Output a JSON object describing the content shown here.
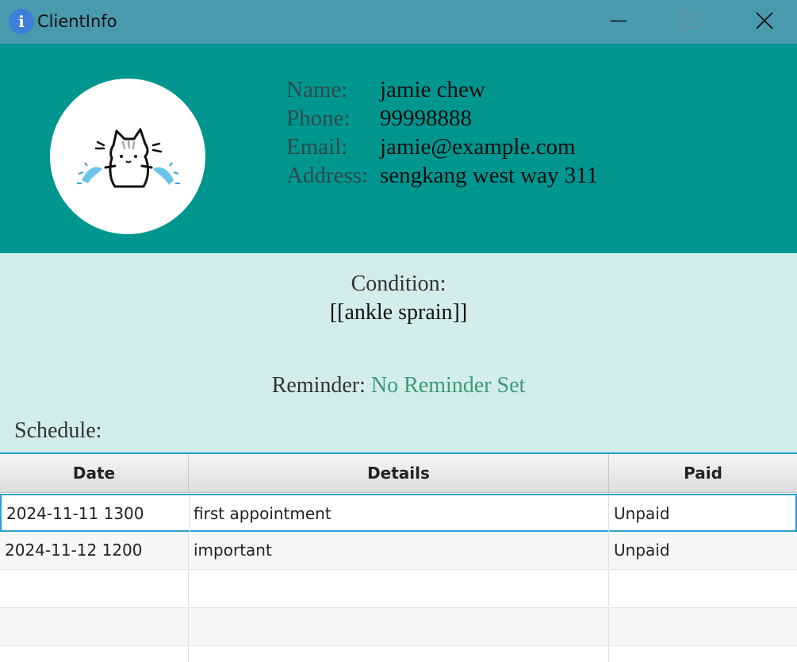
{
  "window": {
    "title": "ClientInfo",
    "icon": "info-icon",
    "controls": [
      "minimize-icon",
      "maximize-icon",
      "close-icon"
    ]
  },
  "header": {
    "avatar": "cat-avatar-icon",
    "fields": [
      {
        "label": "Name:",
        "value": "jamie chew"
      },
      {
        "label": "Phone:",
        "value": "99998888"
      },
      {
        "label": "Email:",
        "value": "jamie@example.com"
      },
      {
        "label": "Address:",
        "value": "sengkang west way 311"
      }
    ]
  },
  "condition": {
    "label": "Condition:",
    "value": "[[ankle sprain]]"
  },
  "reminder": {
    "label": "Reminder:",
    "value": "No Reminder Set"
  },
  "schedule": {
    "label": "Schedule:",
    "columns": [
      "Date",
      "Details",
      "Paid"
    ],
    "rows": [
      {
        "date": "2024-11-11 1300",
        "details": "first appointment",
        "paid": "Unpaid"
      },
      {
        "date": "2024-11-12 1200",
        "details": "important",
        "paid": "Unpaid"
      }
    ]
  },
  "colors": {
    "titlebar": "#4a9aad",
    "header_bg": "#009690",
    "panel_bg": "#d3ede9",
    "reminder_value": "#3a9a78",
    "selection": "#2aa0d4"
  }
}
